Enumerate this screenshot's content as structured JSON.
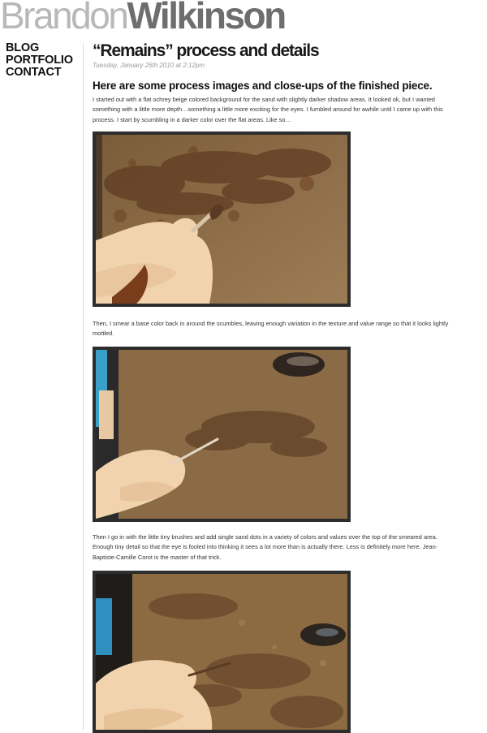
{
  "header": {
    "title_first": "Brandon",
    "title_last": "Wilkinson"
  },
  "nav": {
    "items": [
      {
        "label": "BLOG"
      },
      {
        "label": "PORTFOLIO"
      },
      {
        "label": "CONTACT"
      }
    ]
  },
  "post": {
    "title": "“Remains” process and details",
    "date": "Tuesday, January 26th 2010 at 2:12pm",
    "subheading": "Here are some process images and close-ups of the finished piece.",
    "paragraphs": [
      "I started out with a flat ochrey beige colored background for the sand with slightly darker shadow areas. It looked ok, but I wanted something with a little more depth…something a little more exciting for the eyes. I fumbled around for awhile until I came up with this process. I start by scumbling in a darker color over the flat areas. Like so…",
      "Then, I smear a base color back in around the scumbles, leaving enough variation in the texture and value range so that it looks lightly mottled.",
      "Then I go in with the little tiny brushes and add single sand dots in a variety of colors and values over the top of the smeared area. Enough tiny detail so that the eye is fooled into thinking it sees a lot more than is actually there. Less is definitely more here. Jean-Baptiste-Camille Corot is the master of that trick."
    ]
  },
  "colors": {
    "sand": "#8a6a44",
    "sand_dark": "#6e5234",
    "skin": "#f0d2ae",
    "frame": "#2d2d2d",
    "blue_accent": "#3aa0c8"
  }
}
